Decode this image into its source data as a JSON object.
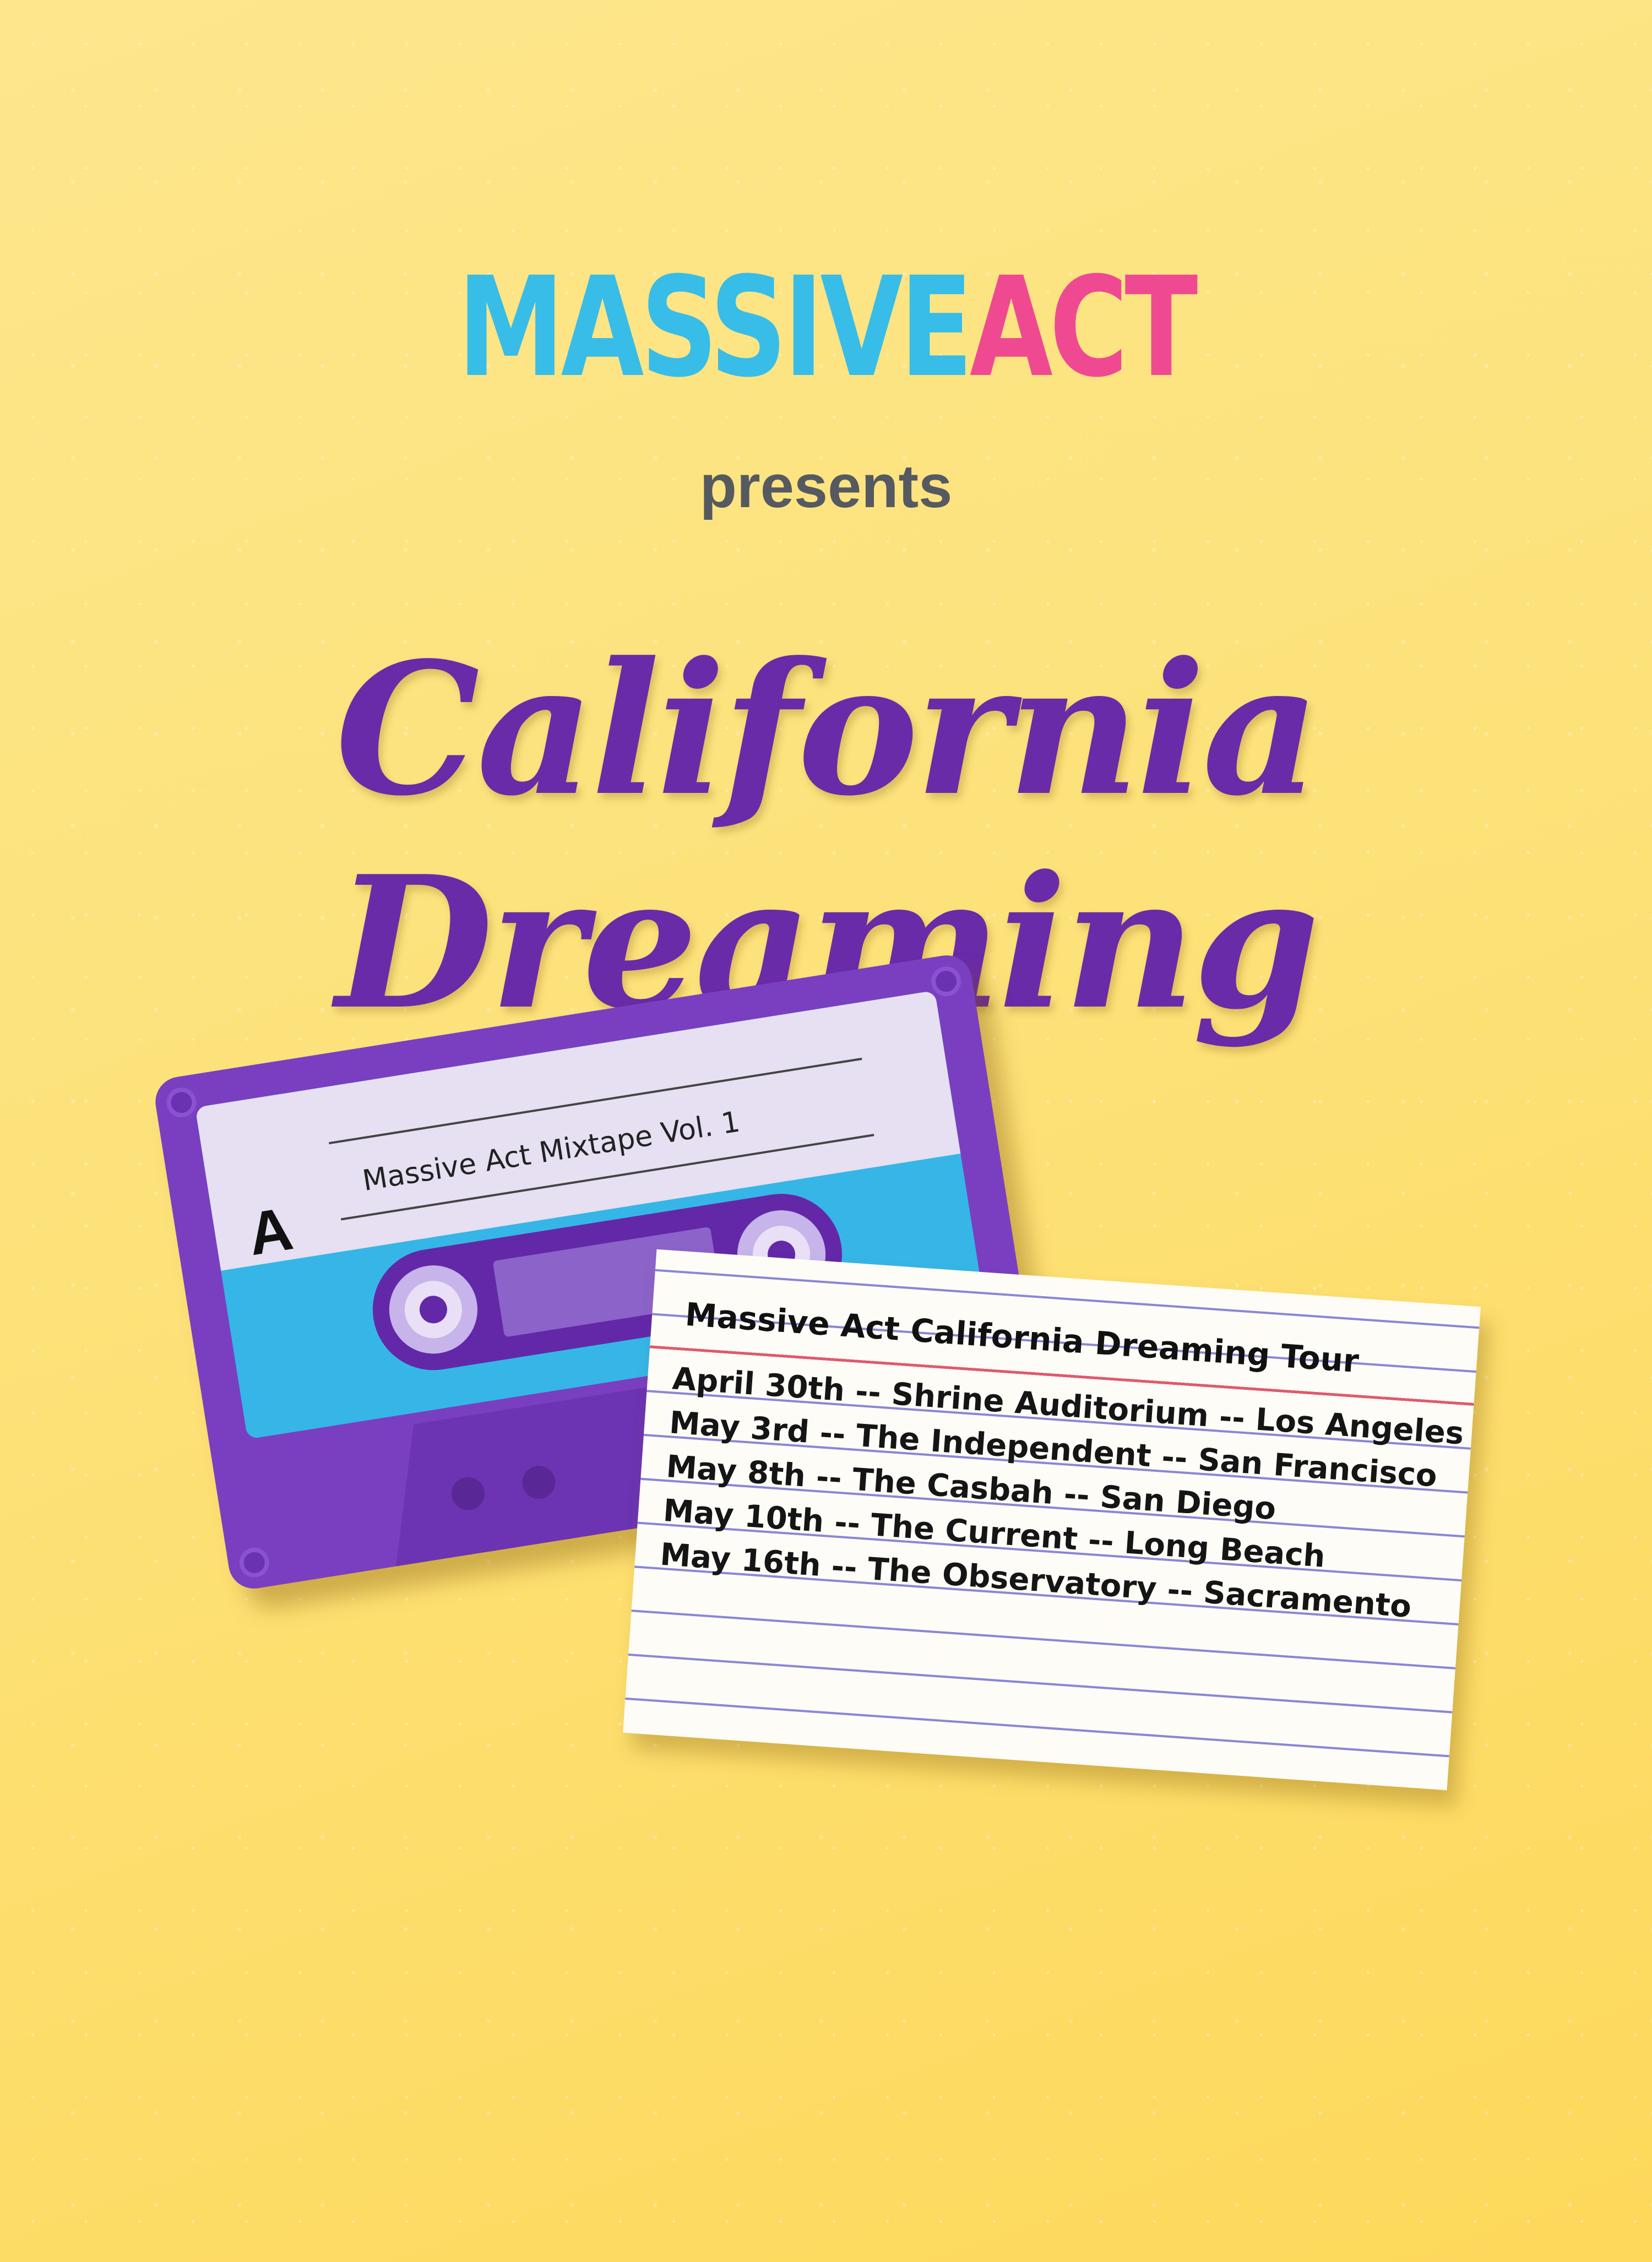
{
  "brand": {
    "part1": "MASSIVE",
    "part2": "ACT",
    "color1": "#37bde8",
    "color2": "#ef4a91"
  },
  "presents": "presents",
  "title": "California Dreaming",
  "cassette": {
    "side": "A",
    "label": "Massive Act Mixtape Vol. 1",
    "color": "#7a3fc0"
  },
  "card": {
    "title": "Massive Act California Dreaming Tour",
    "dates": [
      "April 30th  --  Shrine Auditorium  --  Los Angeles",
      "May 3rd  --  The Independent  --  San Francisco",
      "May 8th  --  The Casbah  --  San Diego",
      "May 10th  --  The Current  --  Long Beach",
      "May 16th  --  The Observatory  --  Sacramento"
    ]
  }
}
